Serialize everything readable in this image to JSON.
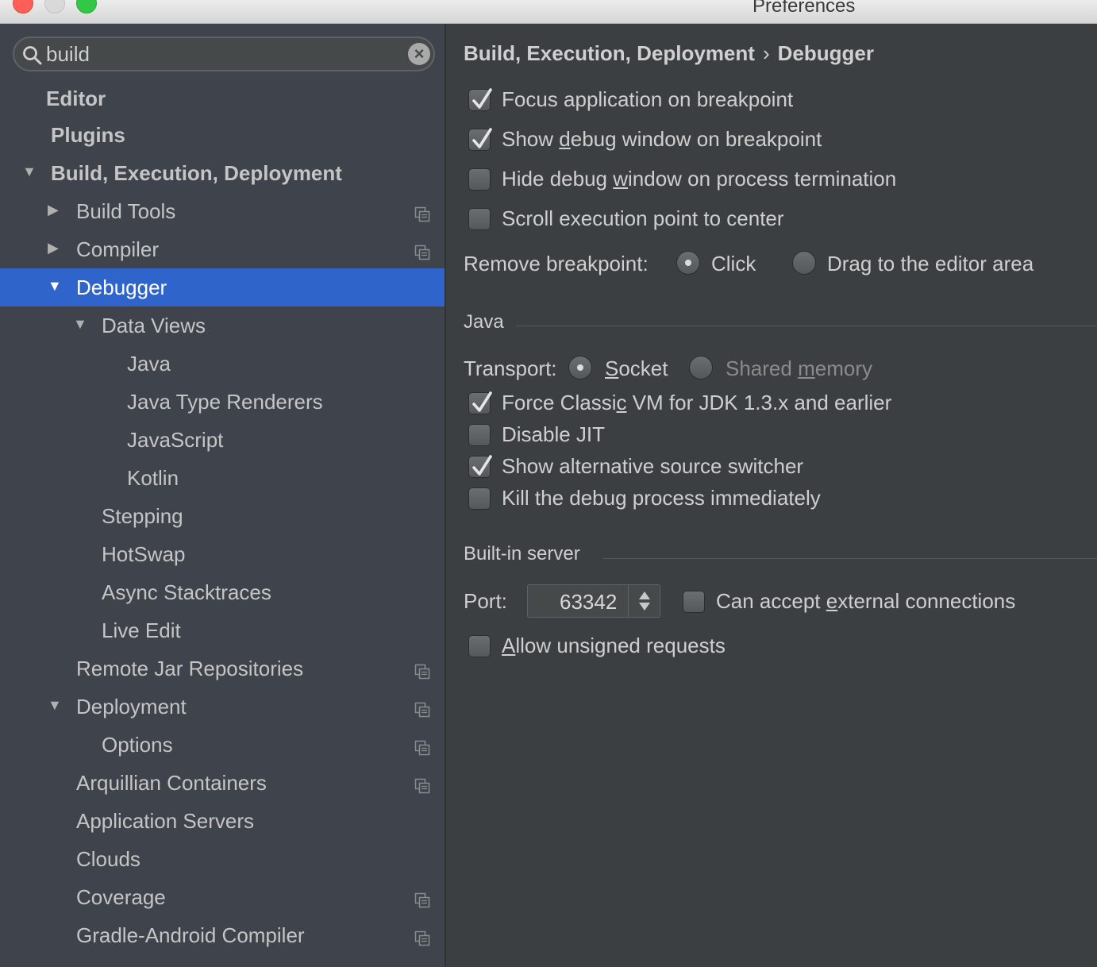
{
  "window": {
    "title": "Preferences"
  },
  "search": {
    "value": "build"
  },
  "tree": [
    {
      "label": "Editor",
      "bold": true,
      "indent": 0,
      "arrow": "",
      "proj": false
    },
    {
      "label": "Plugins",
      "bold": true,
      "indent": 0,
      "arrow": "",
      "proj": false
    },
    {
      "label": "Build, Execution, Deployment",
      "bold": true,
      "indent": 0,
      "arrow": "down",
      "proj": false
    },
    {
      "label": "Build Tools",
      "indent": 1,
      "arrow": "right",
      "proj": true
    },
    {
      "label": "Compiler",
      "indent": 1,
      "arrow": "right",
      "proj": true
    },
    {
      "label": "Debugger",
      "indent": 1,
      "arrow": "down",
      "proj": false,
      "selected": true
    },
    {
      "label": "Data Views",
      "indent": 2,
      "arrow": "down",
      "proj": false
    },
    {
      "label": "Java",
      "indent": 3,
      "arrow": "",
      "proj": false
    },
    {
      "label": "Java Type Renderers",
      "indent": 3,
      "arrow": "",
      "proj": false
    },
    {
      "label": "JavaScript",
      "indent": 3,
      "arrow": "",
      "proj": false
    },
    {
      "label": "Kotlin",
      "indent": 3,
      "arrow": "",
      "proj": false
    },
    {
      "label": "Stepping",
      "indent": 2,
      "arrow": "",
      "proj": false
    },
    {
      "label": "HotSwap",
      "indent": 2,
      "arrow": "",
      "proj": false
    },
    {
      "label": "Async Stacktraces",
      "indent": 2,
      "arrow": "",
      "proj": false
    },
    {
      "label": "Live Edit",
      "indent": 2,
      "arrow": "",
      "proj": false
    },
    {
      "label": "Remote Jar Repositories",
      "indent": 1,
      "arrow": "",
      "proj": true
    },
    {
      "label": "Deployment",
      "indent": 1,
      "arrow": "down",
      "proj": true
    },
    {
      "label": "Options",
      "indent": 2,
      "arrow": "",
      "proj": true
    },
    {
      "label": "Arquillian Containers",
      "indent": 1,
      "arrow": "",
      "proj": true
    },
    {
      "label": "Application Servers",
      "indent": 1,
      "arrow": "",
      "proj": false
    },
    {
      "label": "Clouds",
      "indent": 1,
      "arrow": "",
      "proj": false
    },
    {
      "label": "Coverage",
      "indent": 1,
      "arrow": "",
      "proj": true
    },
    {
      "label": "Gradle-Android Compiler",
      "indent": 1,
      "arrow": "",
      "proj": true
    }
  ],
  "breadcrumb": {
    "parent": "Build, Execution, Deployment",
    "current": "Debugger"
  },
  "general_options": [
    {
      "pre": "Focus application on breakpoint",
      "u": "",
      "post": "",
      "checked": true
    },
    {
      "pre": "Show ",
      "u": "d",
      "post": "ebug window on breakpoint",
      "checked": true
    },
    {
      "pre": "Hide debug ",
      "u": "w",
      "post": "indow on process termination",
      "checked": false
    },
    {
      "pre": "Scroll execution point to center",
      "u": "",
      "post": "",
      "checked": false
    }
  ],
  "remove_breakpoint": {
    "label": "Remove breakpoint:",
    "options": [
      "Click",
      "Drag to the editor area"
    ],
    "selected": 0
  },
  "java": {
    "title": "Java",
    "transport_label": "Transport:",
    "transport_options": [
      {
        "pre": "",
        "u": "S",
        "post": "ocket",
        "enabled": true
      },
      {
        "pre": "Shared ",
        "u": "m",
        "post": "emory",
        "enabled": false
      }
    ],
    "transport_selected": 0,
    "options": [
      {
        "pre": "Force Classi",
        "u": "c",
        "post": " VM for JDK 1.3.x and earlier",
        "checked": true
      },
      {
        "pre": "Disable JIT",
        "u": "",
        "post": "",
        "checked": false
      },
      {
        "pre": "Show alternative source switcher",
        "u": "",
        "post": "",
        "checked": true
      },
      {
        "pre": "Kill the debug process immediately",
        "u": "",
        "post": "",
        "checked": false
      }
    ]
  },
  "server": {
    "title": "Built-in server",
    "port_label": "Port:",
    "port_value": "63342",
    "external": {
      "pre": "Can accept ",
      "u": "e",
      "post": "xternal connections",
      "checked": false
    },
    "unsigned": {
      "pre": "",
      "u": "A",
      "post": "llow unsigned requests",
      "checked": false
    }
  },
  "colors": {
    "selection": "#2f65ca",
    "sidebar": "#3e434c",
    "panel": "#3c3f41"
  }
}
